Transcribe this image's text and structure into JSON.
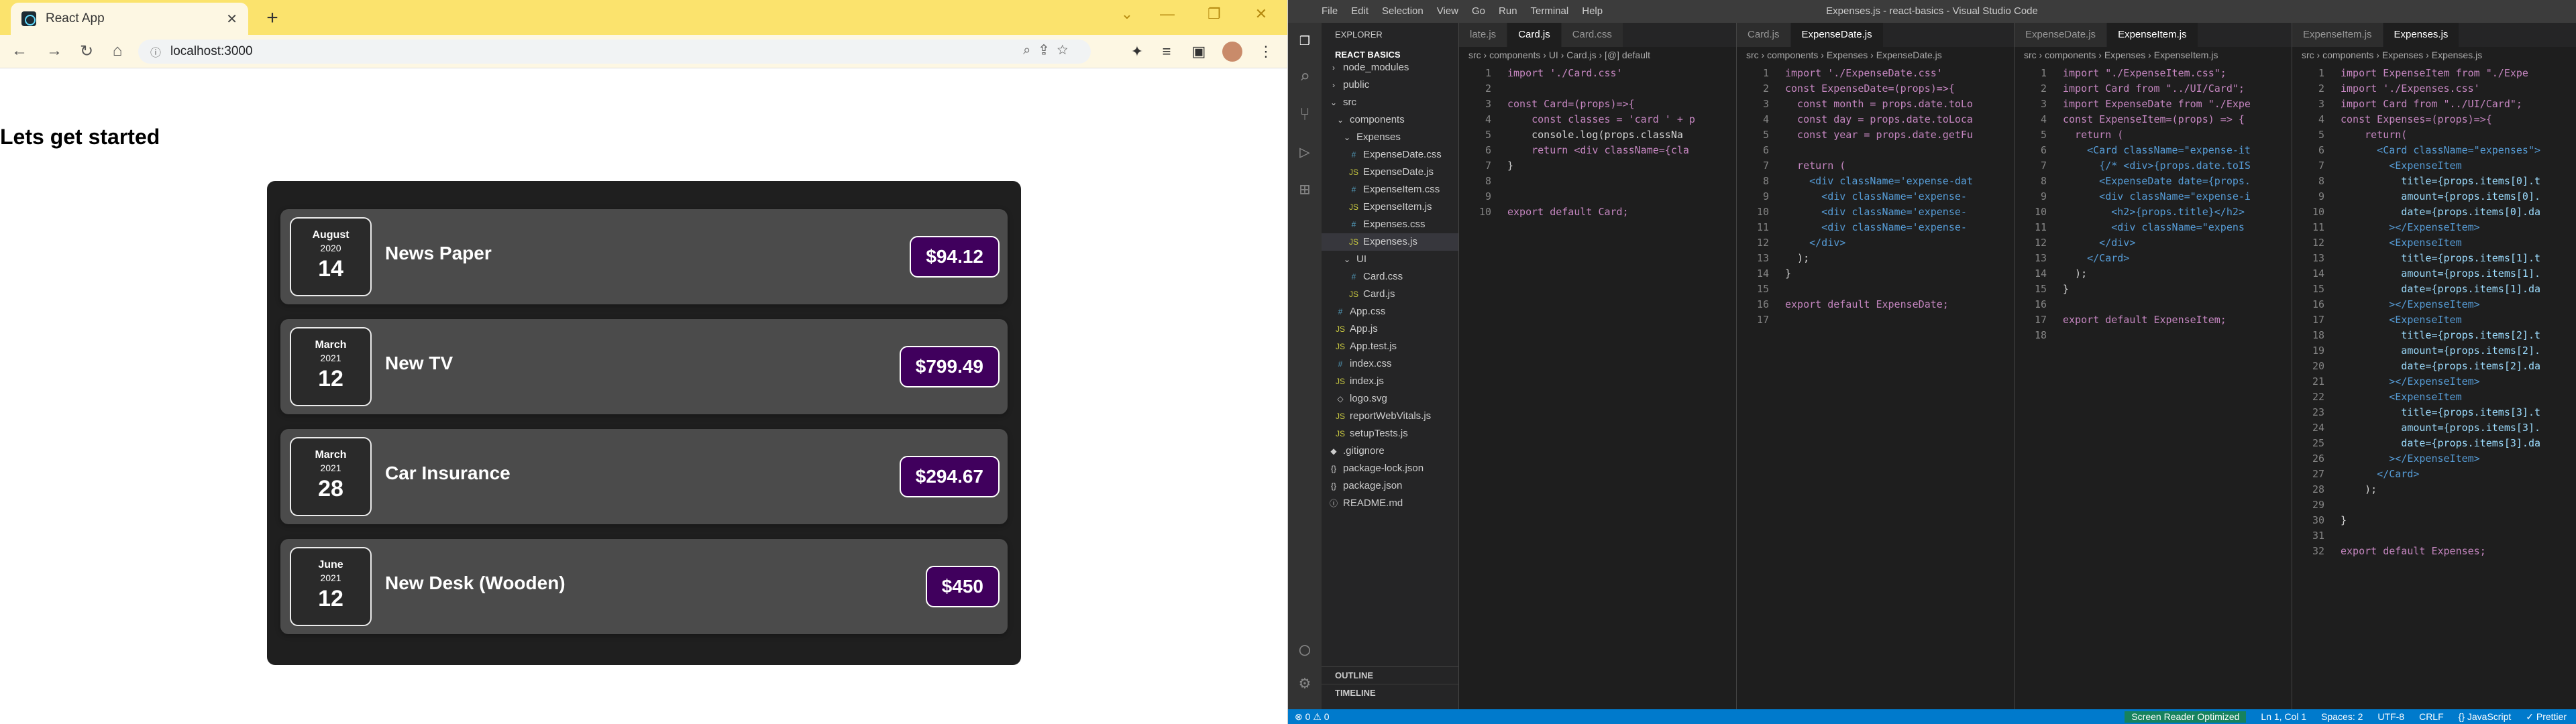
{
  "browser": {
    "tab_title": "React App",
    "tab_close": "✕",
    "new_tab": "+",
    "url": "localhost:3000",
    "page_heading": "Lets get started",
    "expenses": [
      {
        "month": "August",
        "year": "2020",
        "day": "14",
        "title": "News Paper",
        "amount": "$94.12"
      },
      {
        "month": "March",
        "year": "2021",
        "day": "12",
        "title": "New TV",
        "amount": "$799.49"
      },
      {
        "month": "March",
        "year": "2021",
        "day": "28",
        "title": "Car Insurance",
        "amount": "$294.67"
      },
      {
        "month": "June",
        "year": "2021",
        "day": "12",
        "title": "New Desk (Wooden)",
        "amount": "$450"
      }
    ],
    "accent": "#40005d"
  },
  "vscode": {
    "window_title": "Expenses.js - react-basics - Visual Studio Code",
    "menu": [
      "File",
      "Edit",
      "Selection",
      "View",
      "Go",
      "Run",
      "Terminal",
      "Help"
    ],
    "explorer_label": "EXPLORER",
    "project": "REACT BASICS",
    "tree": [
      {
        "label": "node_modules",
        "indent": 1,
        "icon": "›"
      },
      {
        "label": "public",
        "indent": 1,
        "icon": "›"
      },
      {
        "label": "src",
        "indent": 1,
        "icon": "⌄"
      },
      {
        "label": "components",
        "indent": 2,
        "icon": "⌄"
      },
      {
        "label": "Expenses",
        "indent": 3,
        "icon": "⌄"
      },
      {
        "label": "ExpenseDate.css",
        "indent": 4,
        "icon": "#"
      },
      {
        "label": "ExpenseDate.js",
        "indent": 4,
        "icon": "JS"
      },
      {
        "label": "ExpenseItem.css",
        "indent": 4,
        "icon": "#"
      },
      {
        "label": "ExpenseItem.js",
        "indent": 4,
        "icon": "JS"
      },
      {
        "label": "Expenses.css",
        "indent": 4,
        "icon": "#"
      },
      {
        "label": "Expenses.js",
        "indent": 4,
        "icon": "JS",
        "selected": true
      },
      {
        "label": "UI",
        "indent": 3,
        "icon": "⌄"
      },
      {
        "label": "Card.css",
        "indent": 4,
        "icon": "#"
      },
      {
        "label": "Card.js",
        "indent": 4,
        "icon": "JS"
      },
      {
        "label": "App.css",
        "indent": 2,
        "icon": "#"
      },
      {
        "label": "App.js",
        "indent": 2,
        "icon": "JS"
      },
      {
        "label": "App.test.js",
        "indent": 2,
        "icon": "JS"
      },
      {
        "label": "index.css",
        "indent": 2,
        "icon": "#"
      },
      {
        "label": "index.js",
        "indent": 2,
        "icon": "JS"
      },
      {
        "label": "logo.svg",
        "indent": 2,
        "icon": "◇"
      },
      {
        "label": "reportWebVitals.js",
        "indent": 2,
        "icon": "JS"
      },
      {
        "label": "setupTests.js",
        "indent": 2,
        "icon": "JS"
      },
      {
        "label": ".gitignore",
        "indent": 1,
        "icon": "◆"
      },
      {
        "label": "package-lock.json",
        "indent": 1,
        "icon": "{}"
      },
      {
        "label": "package.json",
        "indent": 1,
        "icon": "{}"
      },
      {
        "label": "README.md",
        "indent": 1,
        "icon": "ⓘ"
      }
    ],
    "outline_label": "OUTLINE",
    "timeline_label": "TIMELINE",
    "panes": [
      {
        "tabs": [
          "late.js",
          "Card.js",
          "Card.css"
        ],
        "active": 1,
        "crumb": "src › components › UI › Card.js › [@] default",
        "lines": [
          "import './Card.css'",
          "",
          "const Card=(props)=>{",
          "    const classes = 'card ' + p",
          "    console.log(props.classNa",
          "    return <div className={cla",
          "}",
          "",
          "",
          "export default Card;"
        ]
      },
      {
        "tabs": [
          "Card.js",
          "ExpenseDate.js"
        ],
        "active": 1,
        "crumb": "src › components › Expenses › ExpenseDate.js",
        "lines": [
          "import './ExpenseDate.css'",
          "const ExpenseDate=(props)=>{",
          "  const month = props.date.toLo",
          "  const day = props.date.toLoca",
          "  const year = props.date.getFu",
          "",
          "  return (",
          "    <div className='expense-dat",
          "      <div className='expense-",
          "      <div className='expense-",
          "      <div className='expense-",
          "    </div>",
          "  );",
          "}",
          "",
          "export default ExpenseDate;",
          ""
        ]
      },
      {
        "tabs": [
          "ExpenseDate.js",
          "ExpenseItem.js"
        ],
        "active": 1,
        "crumb": "src › components › Expenses › ExpenseItem.js",
        "lines": [
          "import \"./ExpenseItem.css\";",
          "import Card from \"../UI/Card\";",
          "import ExpenseDate from \"./Expe",
          "const ExpenseItem=(props) => {",
          "  return (",
          "    <Card className=\"expense-it",
          "      {/* <div>{props.date.toIS",
          "      <ExpenseDate date={props.",
          "      <div className=\"expense-i",
          "        <h2>{props.title}</h2>",
          "        <div className=\"expens",
          "      </div>",
          "    </Card>",
          "  );",
          "}",
          "",
          "export default ExpenseItem;",
          ""
        ]
      },
      {
        "tabs": [
          "ExpenseItem.js",
          "Expenses.js"
        ],
        "active": 1,
        "crumb": "src › components › Expenses › Expenses.js",
        "lines": [
          "import ExpenseItem from \"./Expe",
          "import './Expenses.css'",
          "import Card from \"../UI/Card\";",
          "const Expenses=(props)=>{",
          "    return(",
          "      <Card className=\"expenses\">",
          "        <ExpenseItem",
          "          title={props.items[0].t",
          "          amount={props.items[0].",
          "          date={props.items[0].da",
          "        ></ExpenseItem>",
          "        <ExpenseItem",
          "          title={props.items[1].t",
          "          amount={props.items[1].",
          "          date={props.items[1].da",
          "        ></ExpenseItem>",
          "        <ExpenseItem",
          "          title={props.items[2].t",
          "          amount={props.items[2].",
          "          date={props.items[2].da",
          "        ></ExpenseItem>",
          "        <ExpenseItem",
          "          title={props.items[3].t",
          "          amount={props.items[3].",
          "          date={props.items[3].da",
          "        ></ExpenseItem>",
          "      </Card>",
          "    );",
          "",
          "}",
          "",
          "export default Expenses;"
        ]
      }
    ],
    "status": {
      "left": "⊗ 0 ⚠ 0",
      "screen_reader": "Screen Reader Optimized",
      "position": "Ln 1, Col 1",
      "spaces": "Spaces: 2",
      "encoding": "UTF-8",
      "eol": "CRLF",
      "language": "{} JavaScript",
      "formatter": "✓ Prettier"
    }
  }
}
